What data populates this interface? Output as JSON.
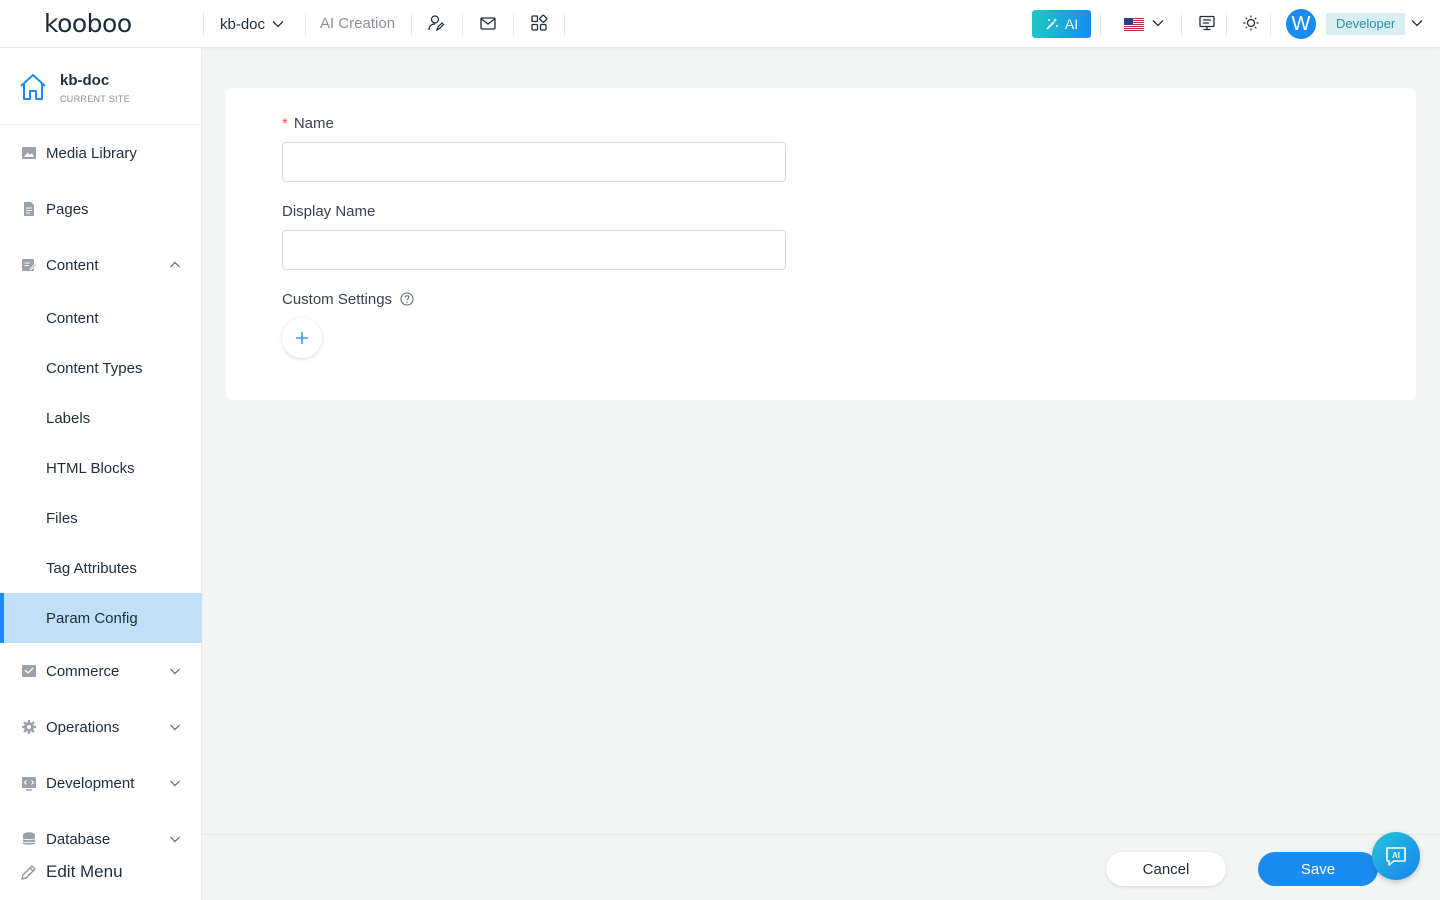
{
  "topbar": {
    "logo": "kooboo",
    "site_selector": "kb-doc",
    "ai_creation": "AI Creation",
    "ai_button": "AI",
    "role": "Developer",
    "avatar_initial": "W",
    "icons": [
      "user-edit-icon",
      "mail-icon",
      "apps-grid-icon",
      "display-icon",
      "sun-icon"
    ]
  },
  "sidebar": {
    "site": {
      "name": "kb-doc",
      "subtitle": "CURRENT SITE"
    },
    "items": [
      {
        "label": "Media Library",
        "icon": "image-icon"
      },
      {
        "label": "Pages",
        "icon": "page-icon"
      },
      {
        "label": "Content",
        "icon": "content-icon",
        "expanded": true,
        "children": [
          {
            "label": "Content"
          },
          {
            "label": "Content Types"
          },
          {
            "label": "Labels"
          },
          {
            "label": "HTML Blocks"
          },
          {
            "label": "Files"
          },
          {
            "label": "Tag Attributes"
          },
          {
            "label": "Param Config",
            "active": true
          }
        ]
      },
      {
        "label": "Commerce",
        "icon": "commerce-icon"
      },
      {
        "label": "Operations",
        "icon": "gear-icon"
      },
      {
        "label": "Development",
        "icon": "code-icon"
      },
      {
        "label": "Database",
        "icon": "database-icon"
      }
    ],
    "edit_menu": "Edit Menu"
  },
  "form": {
    "name_label": "Name",
    "name_required_mark": "*",
    "name_value": "",
    "display_name_label": "Display Name",
    "display_name_value": "",
    "custom_settings_label": "Custom Settings"
  },
  "footer": {
    "cancel": "Cancel",
    "save": "Save"
  },
  "colors": {
    "accent": "#1a8bf0",
    "active_bg": "#bfe0f7",
    "required": "#f0524a",
    "role_bg": "#d8eef3"
  }
}
